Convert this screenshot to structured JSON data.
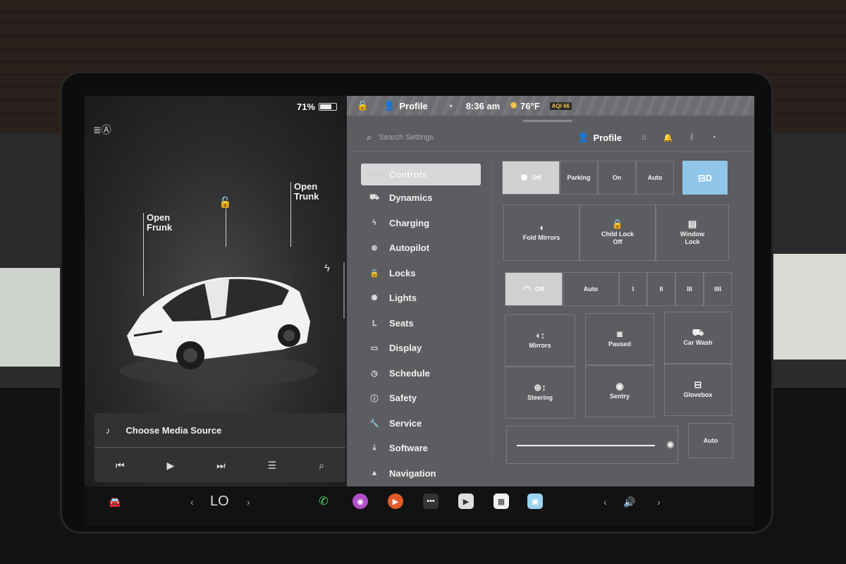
{
  "status": {
    "battery_percent": "71%",
    "battery_level": 0.71,
    "profile": "Profile",
    "time": "8:36 am",
    "temperature": "76°F",
    "aqi": "AQI 66"
  },
  "left_panel": {
    "open_frunk": "Open\nFrunk",
    "open_trunk": "Open\nTrunk",
    "media_source": "Choose Media Source"
  },
  "settings_header": {
    "search_placeholder": "Search Settings",
    "profile": "Profile"
  },
  "nav": [
    {
      "label": "Controls",
      "icon": "toggle-icon"
    },
    {
      "label": "Dynamics",
      "icon": "car-icon"
    },
    {
      "label": "Charging",
      "icon": "bolt-icon"
    },
    {
      "label": "Autopilot",
      "icon": "steering-icon"
    },
    {
      "label": "Locks",
      "icon": "lock-icon"
    },
    {
      "label": "Lights",
      "icon": "sun-icon"
    },
    {
      "label": "Seats",
      "icon": "seat-icon"
    },
    {
      "label": "Display",
      "icon": "display-icon"
    },
    {
      "label": "Schedule",
      "icon": "clock-icon"
    },
    {
      "label": "Safety",
      "icon": "alert-icon"
    },
    {
      "label": "Service",
      "icon": "wrench-icon"
    },
    {
      "label": "Software",
      "icon": "download-icon"
    },
    {
      "label": "Navigation",
      "icon": "navigation-icon"
    }
  ],
  "lights_row": [
    "Off",
    "Parking",
    "On",
    "Auto"
  ],
  "quick_controls": [
    "Fold Mirrors",
    "Child Lock\nOff",
    "Window\nLock"
  ],
  "wiper_row": [
    "Off",
    "Auto",
    "I",
    "II",
    "III",
    "IIII"
  ],
  "grid_controls": [
    "Mirrors",
    "Paused",
    "Car Wash",
    "Steering",
    "Sentry",
    "Glovebox"
  ],
  "brightness": {
    "auto_label": "Auto",
    "level": 0.95
  },
  "dock": {
    "temp_label": "LO"
  },
  "colors": {
    "accent_blue": "#8fc6ea",
    "panel": "#5c5d60",
    "selected": "#d0d0d2"
  }
}
